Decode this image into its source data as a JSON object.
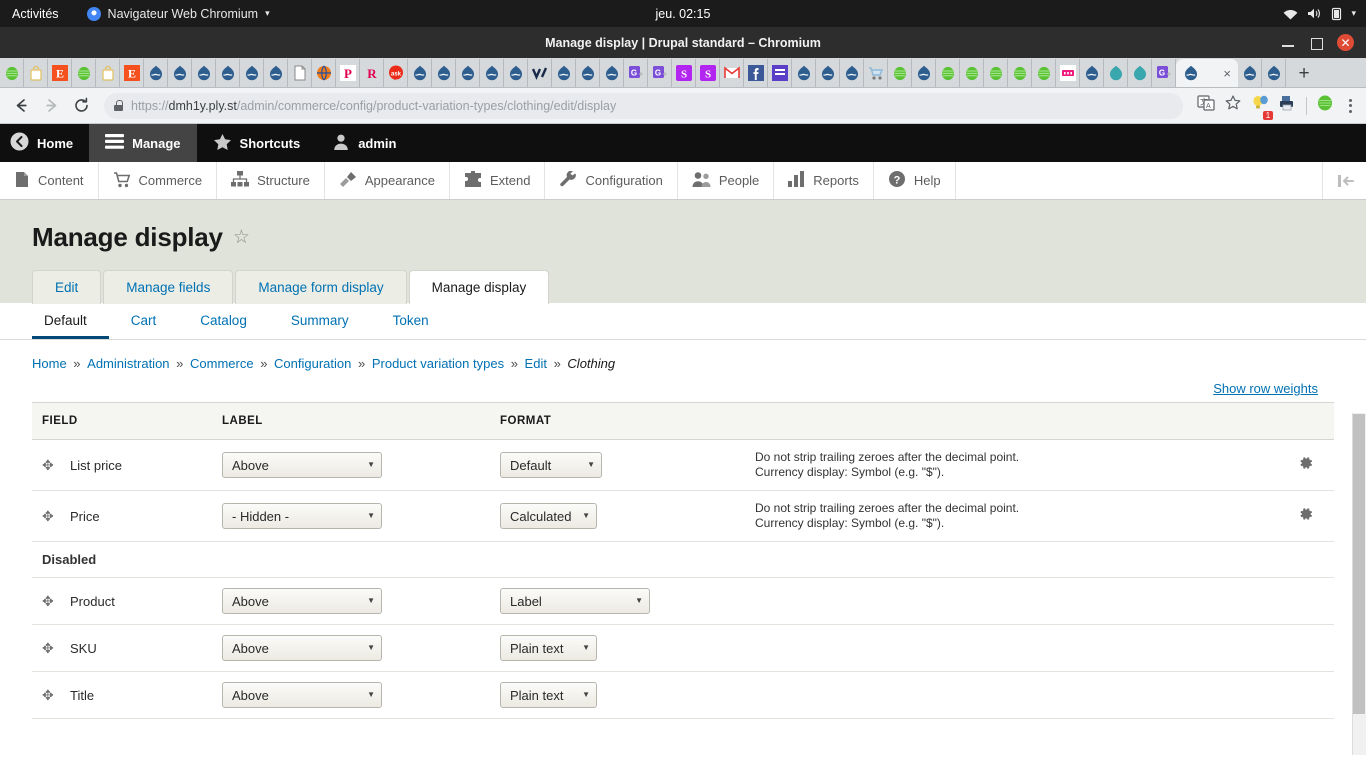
{
  "desktop": {
    "activities": "Activités",
    "app_name": "Navigateur Web Chromium",
    "app_menu_caret": "▾",
    "clock": "jeu. 02:15",
    "tray_icons": [
      "wifi-icon",
      "volume-icon",
      "battery-icon",
      "chevron-down-icon"
    ]
  },
  "window": {
    "title": "Manage display | Drupal standard – Chromium",
    "minimize": "minimize-button",
    "maximize": "maximize-button",
    "close": "✕"
  },
  "browser": {
    "tabs": [
      {
        "favicon": "drupal-green"
      },
      {
        "favicon": "bag"
      },
      {
        "favicon": "e-orange"
      },
      {
        "favicon": "drupal-green"
      },
      {
        "favicon": "bag"
      },
      {
        "favicon": "e-orange"
      },
      {
        "favicon": "drupal-blue"
      },
      {
        "favicon": "drupal-blue"
      },
      {
        "favicon": "drupal-blue"
      },
      {
        "favicon": "drupal-blue"
      },
      {
        "favicon": "drupal-blue"
      },
      {
        "favicon": "drupal-blue"
      },
      {
        "favicon": "page"
      },
      {
        "favicon": "globe"
      },
      {
        "favicon": "p-white"
      },
      {
        "favicon": "r-red"
      },
      {
        "favicon": "ask"
      },
      {
        "favicon": "drupal-blue"
      },
      {
        "favicon": "drupal-blue"
      },
      {
        "favicon": "drupal-blue"
      },
      {
        "favicon": "drupal-blue"
      },
      {
        "favicon": "drupal-blue"
      },
      {
        "favicon": "vi"
      },
      {
        "favicon": "drupal-blue"
      },
      {
        "favicon": "drupal-blue"
      },
      {
        "favicon": "drupal-blue"
      },
      {
        "favicon": "g-purple"
      },
      {
        "favicon": "g-purple"
      },
      {
        "favicon": "s-purple"
      },
      {
        "favicon": "s-purple"
      },
      {
        "favicon": "gmail"
      },
      {
        "favicon": "facebook"
      },
      {
        "favicon": "purple-bar"
      },
      {
        "favicon": "drupal-blue"
      },
      {
        "favicon": "drupal-blue"
      },
      {
        "favicon": "drupal-blue"
      },
      {
        "favicon": "cart"
      },
      {
        "favicon": "drupal-green"
      },
      {
        "favicon": "drupal-blue"
      },
      {
        "favicon": "drupal-green"
      },
      {
        "favicon": "drupal-green"
      },
      {
        "favicon": "drupal-green"
      },
      {
        "favicon": "drupal-green"
      },
      {
        "favicon": "drupal-green"
      },
      {
        "favicon": "red-box"
      },
      {
        "favicon": "drupal-blue"
      },
      {
        "favicon": "drupal-teal"
      },
      {
        "favicon": "drupal-teal"
      },
      {
        "favicon": "g-purple"
      }
    ],
    "active_tab": {
      "favicon": "drupal-blue",
      "close": "×"
    },
    "tabs_after": [
      {
        "favicon": "drupal-blue"
      },
      {
        "favicon": "drupal-blue"
      }
    ],
    "new_tab": "+",
    "back": "back-icon",
    "forward": "forward-icon",
    "reload": "reload-icon",
    "url_scheme": "https://",
    "url_host": "dmh1y.ply.st",
    "url_path": "/admin/commerce/config/product-variation-types/clothing/edit/display",
    "toolbar_icons": [
      "translate-icon",
      "bookmark-star-icon",
      "extension-lightbulb-icon",
      "extension-printer-icon",
      "drupal-extension-icon",
      "menu-kebab-icon"
    ],
    "badge_count": "1"
  },
  "admin_toolbar": {
    "items": [
      {
        "label": "Home",
        "icon": "back-circle-icon",
        "active": false
      },
      {
        "label": "Manage",
        "icon": "hamburger-icon",
        "active": true
      },
      {
        "label": "Shortcuts",
        "icon": "star-icon",
        "active": false
      },
      {
        "label": "admin",
        "icon": "user-icon",
        "active": false
      }
    ]
  },
  "admin_menu": {
    "items": [
      {
        "label": "Content",
        "icon": "content-page-icon"
      },
      {
        "label": "Commerce",
        "icon": "shopping-cart-icon"
      },
      {
        "label": "Structure",
        "icon": "structure-icon"
      },
      {
        "label": "Appearance",
        "icon": "paintbrush-icon"
      },
      {
        "label": "Extend",
        "icon": "puzzle-icon"
      },
      {
        "label": "Configuration",
        "icon": "wrench-icon"
      },
      {
        "label": "People",
        "icon": "people-icon"
      },
      {
        "label": "Reports",
        "icon": "bar-chart-icon"
      },
      {
        "label": "Help",
        "icon": "question-circle-icon"
      }
    ],
    "tray_toggle": "toolbar-orientation-icon"
  },
  "page": {
    "title": "Manage display",
    "favorite_star": "☆",
    "primary_tabs": [
      {
        "label": "Edit",
        "active": false
      },
      {
        "label": "Manage fields",
        "active": false
      },
      {
        "label": "Manage form display",
        "active": false
      },
      {
        "label": "Manage display",
        "active": true
      }
    ],
    "secondary_tabs": [
      {
        "label": "Default",
        "active": true
      },
      {
        "label": "Cart",
        "active": false
      },
      {
        "label": "Catalog",
        "active": false
      },
      {
        "label": "Summary",
        "active": false
      },
      {
        "label": "Token",
        "active": false
      }
    ],
    "breadcrumb": [
      {
        "label": "Home",
        "link": true
      },
      {
        "label": "Administration",
        "link": true
      },
      {
        "label": "Commerce",
        "link": true
      },
      {
        "label": "Configuration",
        "link": true
      },
      {
        "label": "Product variation types",
        "link": true
      },
      {
        "label": "Edit",
        "link": true
      }
    ],
    "breadcrumb_current": "Clothing",
    "breadcrumb_separator": "»",
    "show_row_weights": "Show row weights"
  },
  "table": {
    "headers": {
      "field": "FIELD",
      "label": "LABEL",
      "format": "FORMAT"
    },
    "rows": [
      {
        "kind": "field",
        "name": "List price",
        "label_value": "Above",
        "label_width": "w160",
        "format_value": "Default",
        "format_width": "w102",
        "summary_line1": "Do not strip trailing zeroes after the decimal point.",
        "summary_line2": "Currency display: Symbol (e.g. \"$\").",
        "gear": "settings-gear-icon"
      },
      {
        "kind": "field",
        "name": "Price",
        "label_value": "- Hidden -",
        "label_width": "w160",
        "format_value": "Calculated",
        "format_width": "w97",
        "summary_line1": "Do not strip trailing zeroes after the decimal point.",
        "summary_line2": "Currency display: Symbol (e.g. \"$\").",
        "gear": "settings-gear-icon"
      },
      {
        "kind": "group",
        "name": "Disabled"
      },
      {
        "kind": "field",
        "name": "Product",
        "label_value": "Above",
        "label_width": "w160",
        "format_value": "Label",
        "format_width": "w150",
        "summary_line1": "",
        "summary_line2": "",
        "gear": ""
      },
      {
        "kind": "field",
        "name": "SKU",
        "label_value": "Above",
        "label_width": "w160",
        "format_value": "Plain text",
        "format_width": "w97",
        "summary_line1": "",
        "summary_line2": "",
        "gear": ""
      },
      {
        "kind": "field",
        "name": "Title",
        "label_value": "Above",
        "label_width": "w160",
        "format_value": "Plain text",
        "format_width": "w97",
        "summary_line1": "",
        "summary_line2": "",
        "gear": ""
      }
    ],
    "drag_handle": "✥",
    "select_arrow": "▼"
  },
  "colors": {
    "accent_link": "#0071b3",
    "toolbar_orange": "#f0a020",
    "page_head_bg": "#e0e3d9",
    "close_red": "#e04b35"
  }
}
